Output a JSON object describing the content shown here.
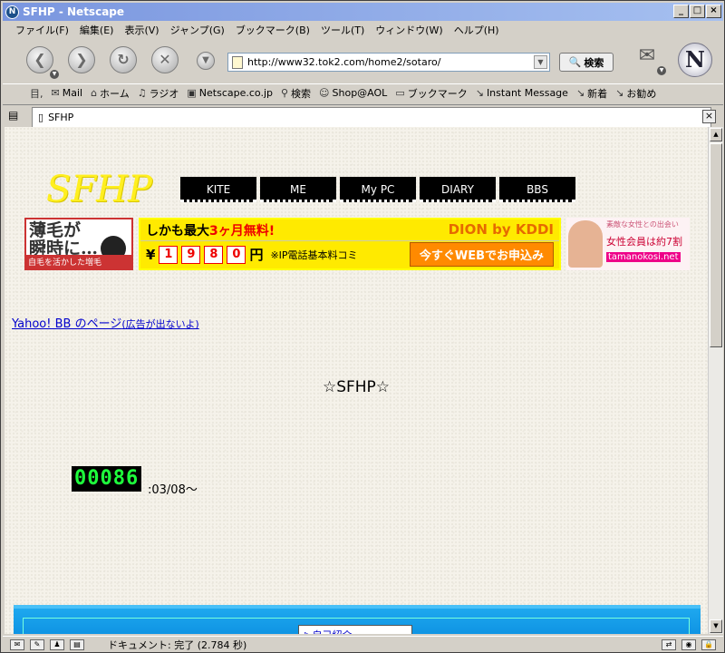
{
  "window": {
    "title": "SFHP - Netscape",
    "app_icon": "N"
  },
  "menu": [
    "ファイル(F)",
    "編集(E)",
    "表示(V)",
    "ジャンプ(G)",
    "ブックマーク(B)",
    "ツール(T)",
    "ウィンドウ(W)",
    "ヘルプ(H)"
  ],
  "nav": {
    "url": "http://www32.tok2.com/home2/sotaro/",
    "search_label": "検索",
    "logo": "N"
  },
  "personal": [
    "Mail",
    "ホーム",
    "ラジオ",
    "Netscape.co.jp",
    "検索",
    "Shop@AOL",
    "ブックマーク",
    "Instant Message",
    "新着",
    "お勧め"
  ],
  "tab": {
    "label": "SFHP"
  },
  "page": {
    "logo": "SFHP",
    "nav_buttons": [
      "KITE",
      "ME",
      "My PC",
      "DIARY",
      "BBS"
    ],
    "ad1": {
      "title_line1": "薄毛が",
      "title_line2": "瞬時に…",
      "sub": "自毛を活かした増毛"
    },
    "ad2": {
      "headline_prefix": "しかも最大",
      "headline_red": "3ヶ月無料!",
      "brand": "DION by KDDI",
      "currency": "¥",
      "digits": [
        "1",
        "9",
        "8",
        "0"
      ],
      "unit": "円",
      "note": "※IP電話基本料コミ",
      "cta": "今すぐWEBでお申込み"
    },
    "ad3": {
      "line1": "素敵な女性との出会い",
      "line2": "女性会員は約7割",
      "line3": "tamanokosi.net"
    },
    "yahoo_link": "Yahoo! BB のページ",
    "yahoo_link_small": "(広告が出ないよ)",
    "heading": "☆SFHP☆",
    "counter": "00086",
    "since": ":03/08～",
    "blue_label": "▷自己紹介"
  },
  "status": {
    "text": "ドキュメント: 完了 (2.784 秒)"
  }
}
